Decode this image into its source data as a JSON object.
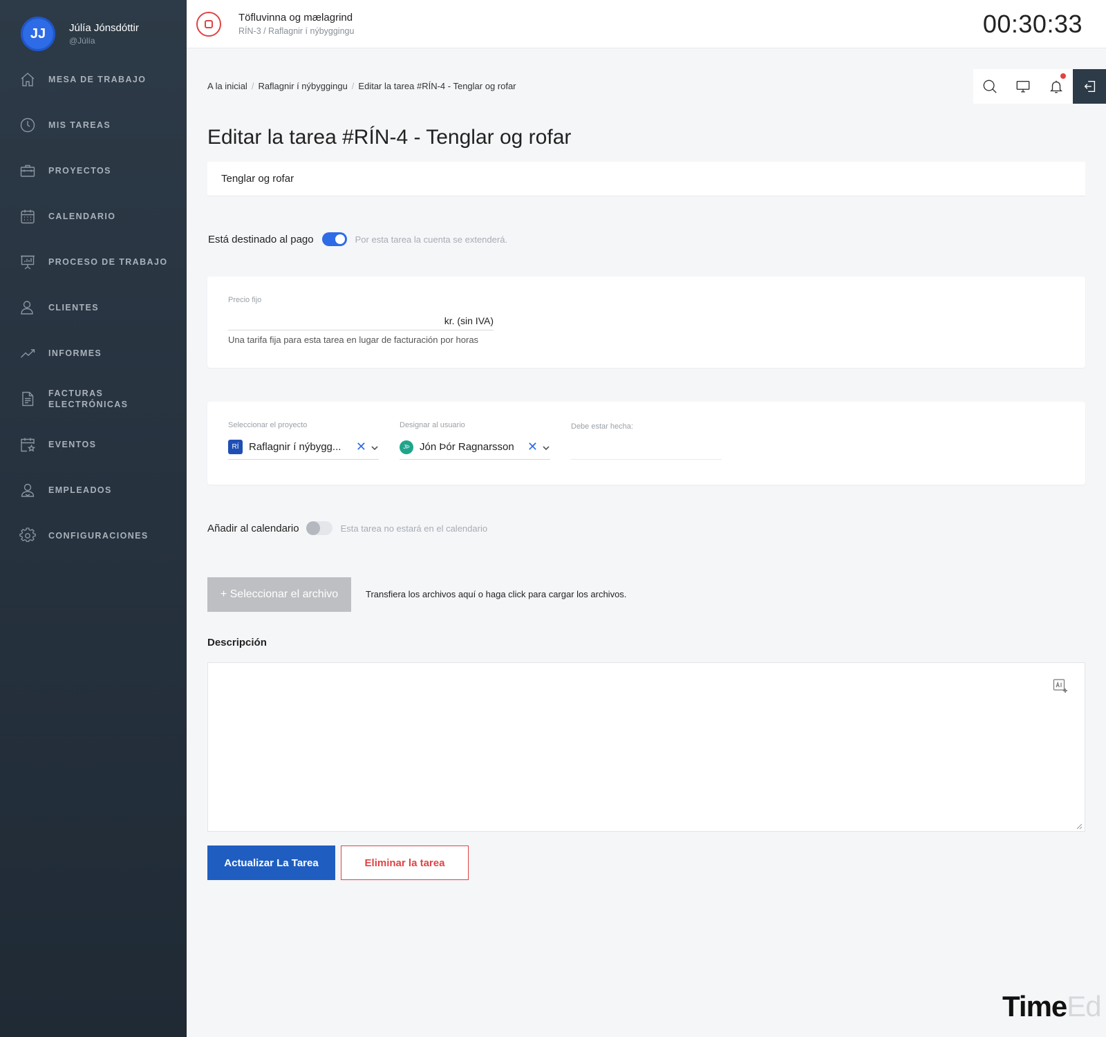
{
  "user": {
    "initials": "JJ",
    "name": "Júlía Jónsdóttir",
    "handle": "@Júlía"
  },
  "sidebar": {
    "items": [
      {
        "label": "MESA DE TRABAJO",
        "icon": "home-icon"
      },
      {
        "label": "MIS TAREAS",
        "icon": "clock-icon"
      },
      {
        "label": "PROYECTOS",
        "icon": "briefcase-icon"
      },
      {
        "label": "CALENDARIO",
        "icon": "calendar-icon"
      },
      {
        "label": "PROCESO DE TRABAJO",
        "icon": "presentation-icon"
      },
      {
        "label": "CLIENTES",
        "icon": "user-icon"
      },
      {
        "label": "INFORMES",
        "icon": "trend-icon"
      },
      {
        "label": "FACTURAS ELECTRÓNICAS",
        "icon": "document-icon"
      },
      {
        "label": "EVENTOS",
        "icon": "calendar-star-icon"
      },
      {
        "label": "EMPLEADOS",
        "icon": "users-icon"
      },
      {
        "label": "CONFIGURACIONES",
        "icon": "gear-icon"
      }
    ]
  },
  "timer": {
    "task_title": "Töfluvinna og mælagrind",
    "task_sub": "RÍN-3 / Raflagnir í nýbyggingu",
    "clock": "00:30:33"
  },
  "breadcrumb": {
    "home": "A la inicial",
    "project": "Raflagnir í nýbyggingu",
    "current": "Editar la tarea #RÍN-4 - Tenglar og rofar"
  },
  "page_title": "Editar la tarea #RÍN-4 - Tenglar og rofar",
  "task_name": "Tenglar og rofar",
  "payment": {
    "label": "Está destinado al pago",
    "enabled": true,
    "hint": "Por esta tarea la cuenta se extenderá."
  },
  "price": {
    "label": "Precio fijo",
    "value": "",
    "suffix": "kr. (sin IVA)",
    "help": "Una tarifa fija para esta tarea en lugar de facturación por horas"
  },
  "assign": {
    "project_label": "Seleccionar el proyecto",
    "project_badge": "RÍ",
    "project_value": "Raflagnir í nýbygg...",
    "user_label": "Designar al usuario",
    "user_badge": "JÞ",
    "user_value": "Jón Þór Ragnarsson",
    "due_label": "Debe estar hecha:",
    "due_value": ""
  },
  "calendar": {
    "label": "Añadir al calendario",
    "enabled": false,
    "hint": "Esta tarea no estará en el calendario"
  },
  "files": {
    "button": "+ Seleccionar el archivo",
    "hint": "Transfiera los archivos aquí o haga click para cargar los archivos."
  },
  "description": {
    "label": "Descripción",
    "value": ""
  },
  "actions": {
    "update": "Actualizar La Tarea",
    "delete": "Eliminar la tarea"
  },
  "brand": {
    "bold": "Time",
    "light": "Ed"
  },
  "colors": {
    "accent": "#2e6be6",
    "primary_button": "#1f5ec0",
    "danger": "#e04343",
    "sidebar": "#2d3a47"
  }
}
